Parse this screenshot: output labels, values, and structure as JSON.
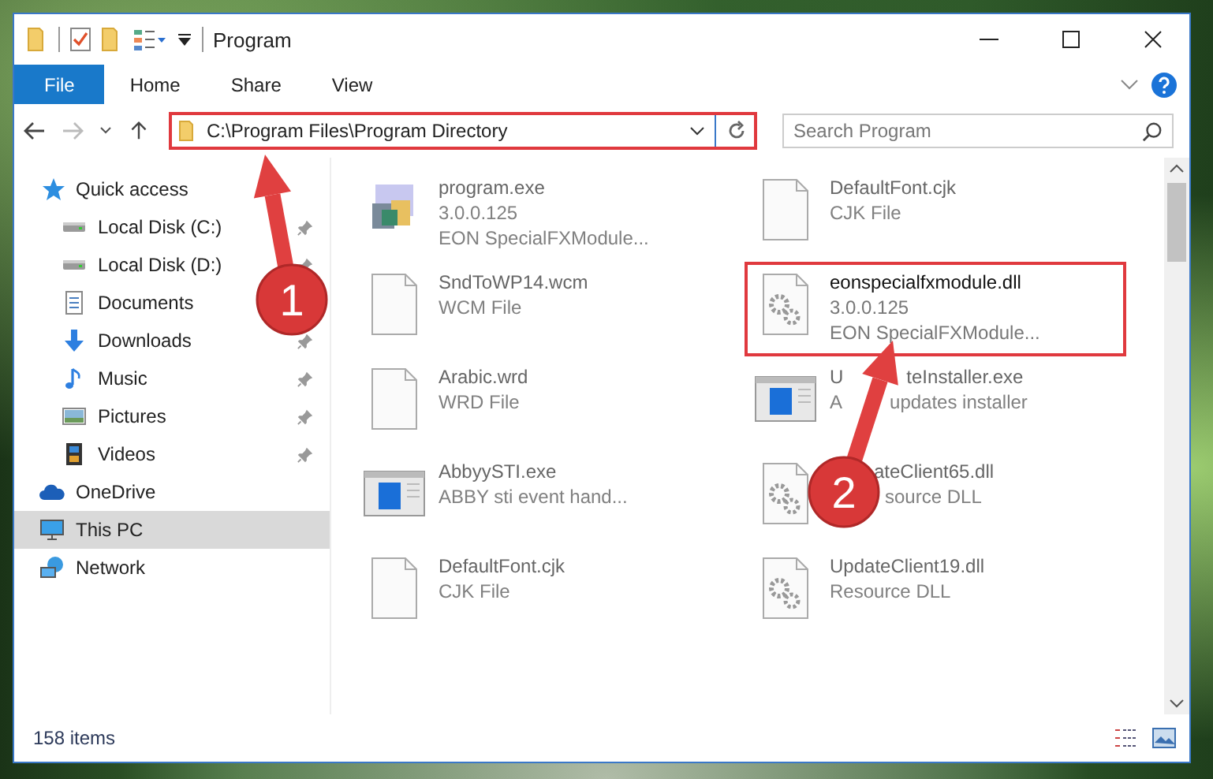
{
  "window": {
    "title": "Program"
  },
  "ribbon_tabs": [
    {
      "label": "File",
      "selected": true
    },
    {
      "label": "Home",
      "selected": false
    },
    {
      "label": "Share",
      "selected": false
    },
    {
      "label": "View",
      "selected": false
    }
  ],
  "address_bar": {
    "path": "C:\\Program Files\\Program Directory",
    "highlighted": true
  },
  "search": {
    "placeholder": "Search Program"
  },
  "sidebar": {
    "items": [
      {
        "label": "Quick access",
        "kind": "quick",
        "selected": false,
        "children": [
          {
            "label": "Local Disk (C:)",
            "kind": "disk",
            "pinned": true
          },
          {
            "label": "Local Disk (D:)",
            "kind": "disk",
            "pinned": true
          },
          {
            "label": "Documents",
            "kind": "documents"
          },
          {
            "label": "Downloads",
            "kind": "downloads",
            "pinned": true
          },
          {
            "label": "Music",
            "kind": "music",
            "pinned": true
          },
          {
            "label": "Pictures",
            "kind": "pictures",
            "pinned": true
          },
          {
            "label": "Videos",
            "kind": "videos",
            "pinned": true
          }
        ]
      },
      {
        "label": "OneDrive",
        "kind": "cloud",
        "selected": false
      },
      {
        "label": "This PC",
        "kind": "pc",
        "selected": true
      },
      {
        "label": "Network",
        "kind": "network",
        "selected": false
      }
    ]
  },
  "files": [
    {
      "name": [
        "program.exe"
      ],
      "kind": "program",
      "lines": [
        [
          "3.0.0.125"
        ],
        [
          "EON SpecialFXModule..."
        ]
      ],
      "highlighted": false,
      "start_covered": false
    },
    {
      "name": [
        "DefaultFont.cjk"
      ],
      "kind": "document",
      "lines": [
        [
          "CJK File"
        ]
      ],
      "highlighted": false,
      "start_covered": false
    },
    {
      "name": [
        "SndToWP14.wcm"
      ],
      "kind": "document",
      "lines": [
        [
          "WCM File"
        ]
      ],
      "highlighted": false,
      "start_covered": false
    },
    {
      "name": [
        "eonspecialfxmodule.dll"
      ],
      "kind": "library",
      "lines": [
        [
          "3.0.0.125"
        ],
        [
          "EON SpecialFXModule..."
        ]
      ],
      "highlighted": true,
      "start_covered": false
    },
    {
      "name": [
        "Arabic.wrd"
      ],
      "kind": "document",
      "lines": [
        [
          "WRD File"
        ]
      ],
      "highlighted": false,
      "start_covered": false
    },
    {
      "name": [
        "U",
        "teInstaller.exe"
      ],
      "kind": "installer",
      "lines": [
        [
          "A",
          "updates installer"
        ]
      ],
      "highlighted": false,
      "start_covered": false
    },
    {
      "name": [
        "AbbyySTI.exe"
      ],
      "kind": "installer",
      "lines": [
        [
          "ABBY sti event hand..."
        ]
      ],
      "highlighted": false,
      "start_covered": false
    },
    {
      "name": [
        "ateClient65.dll"
      ],
      "kind": "library",
      "lines": [
        [
          "source DLL"
        ]
      ],
      "highlighted": false,
      "start_covered": true
    },
    {
      "name": [
        "DefaultFont.cjk"
      ],
      "kind": "document",
      "lines": [
        [
          "CJK File"
        ]
      ],
      "highlighted": false,
      "start_covered": false
    },
    {
      "name": [
        "UpdateClient19.dll"
      ],
      "kind": "library",
      "lines": [
        [
          "Resource DLL"
        ]
      ],
      "highlighted": false,
      "start_covered": false
    }
  ],
  "status_bar": {
    "item_count": "158 items"
  },
  "annotations": [
    {
      "number": "1"
    },
    {
      "number": "2"
    }
  ]
}
